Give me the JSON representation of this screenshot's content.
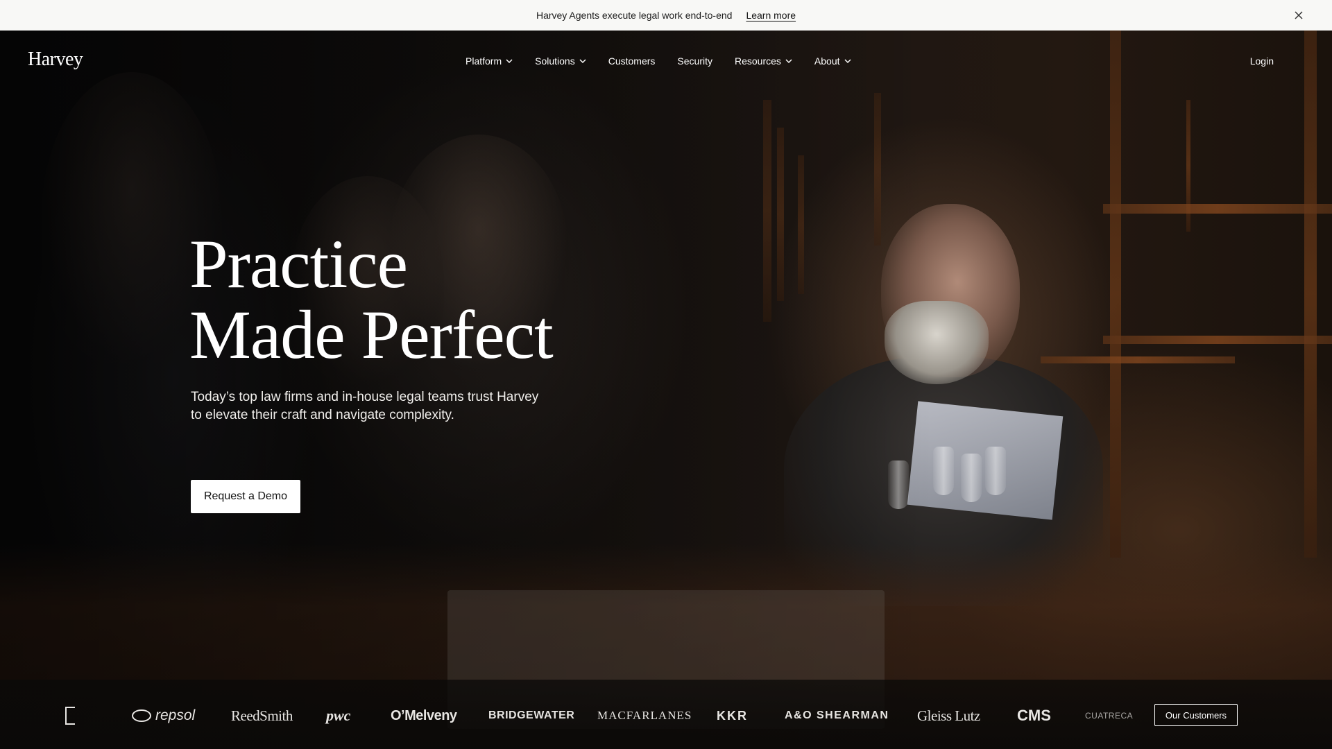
{
  "announcement": {
    "message": "Harvey Agents execute legal work end-to-end",
    "link": "Learn more"
  },
  "header": {
    "logo": "Harvey",
    "nav": [
      {
        "label": "Platform",
        "dropdown": true
      },
      {
        "label": "Solutions",
        "dropdown": true
      },
      {
        "label": "Customers",
        "dropdown": false
      },
      {
        "label": "Security",
        "dropdown": false
      },
      {
        "label": "Resources",
        "dropdown": true
      },
      {
        "label": "About",
        "dropdown": true
      }
    ],
    "login": "Login"
  },
  "hero": {
    "headline_line1": "Practice",
    "headline_line2": "Made Perfect",
    "subtext": "Today’s top law firms and in-house legal teams trust Harvey to elevate their craft and navigate complexity.",
    "cta": "Request a Demo"
  },
  "customers": {
    "logos": [
      "repsol",
      "ReedSmith",
      "pwc",
      "O’Melveny",
      "BRIDGEWATER",
      "MACFARLANES",
      "KKR",
      "A&O SHEARMAN",
      "Gleiss Lutz",
      "CMS",
      "CUATRECA"
    ],
    "button": "Our Customers"
  },
  "icons": {
    "close": "close-icon",
    "chevron": "chevron-down-icon"
  }
}
